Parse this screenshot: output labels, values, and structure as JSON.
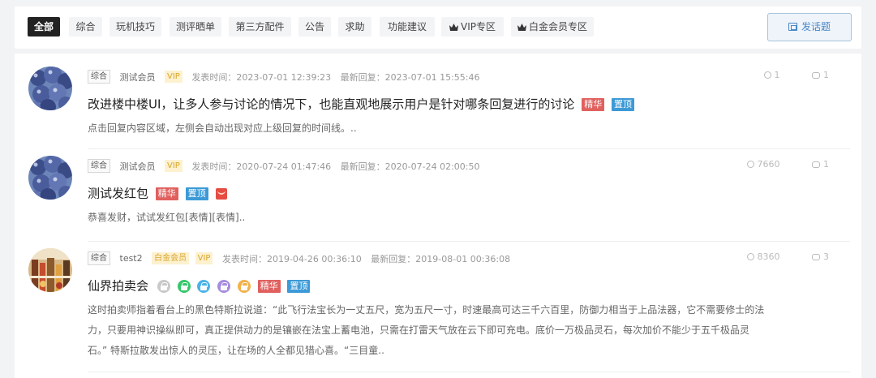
{
  "categories": [
    {
      "label": "全部",
      "active": true
    },
    {
      "label": "综合"
    },
    {
      "label": "玩机技巧"
    },
    {
      "label": "测评晒单"
    },
    {
      "label": "第三方配件"
    },
    {
      "label": "公告"
    },
    {
      "label": "求助"
    },
    {
      "label": "功能建议"
    },
    {
      "label": "VIP专区",
      "icon": "crown-icon"
    },
    {
      "label": "白金会员专区",
      "icon": "crown-icon"
    }
  ],
  "post_button": {
    "label": "发话题",
    "icon": "post-icon"
  },
  "posts": [
    {
      "category": "综合",
      "username": "测试会员",
      "badges": [
        "VIP"
      ],
      "posted": "发表时间：2023-07-01 12:39:23",
      "replied": "最新回复：2023-07-01 15:55:46",
      "views": "1",
      "replies": "1",
      "title": "改进楼中楼UI，让多人参与讨论的情况下，也能直观地展示用户是针对哪条回复进行的讨论",
      "flags": [
        "精华",
        "置顶"
      ],
      "excerpt": "点击回复内容区域，左侧会自动出现对应上级回复的时间线。.."
    },
    {
      "category": "综合",
      "username": "测试会员",
      "badges": [
        "VIP"
      ],
      "posted": "发表时间：2020-07-24 01:47:46",
      "replied": "最新回复：2020-07-24 02:00:50",
      "views": "7660",
      "replies": "1",
      "title": "测试发红包",
      "flags": [
        "精华",
        "置顶"
      ],
      "excerpt": "恭喜发财，试试发红包[表情][表情].."
    },
    {
      "category": "综合",
      "username": "test2",
      "badges": [
        "白金会员",
        "VIP"
      ],
      "posted": "发表时间：2019-04-26 00:36:10",
      "replied": "最新回复：2019-08-01 00:36:08",
      "views": "8360",
      "replies": "3",
      "title": "仙界拍卖会",
      "flags": [
        "精华",
        "置顶"
      ],
      "excerpt": "这时拍卖师指着看台上的黑色特斯拉说道：“此飞行法宝长为一丈五尺，宽为五尺一寸，时速最高可达三千六百里，防御力相当于上品法器，它不需要修士的法力，只要用神识操纵即可，真正提供动力的是镶嵌在法宝上蓄电池，只需在打雷天气放在云下即可充电。底价一万极品灵石，每次加价不能少于五千极品灵石。” 特斯拉散发出惊人的灵压，让在场的人全都见猎心喜。“三目童.."
    }
  ],
  "colors": {
    "accent": "#3d9ad6",
    "essence": "#e0605e",
    "vip": "#d9a52b",
    "active_tab": "#222222"
  },
  "lock_colors": [
    "#c9c9c9",
    "#35c76a",
    "#4bb3e8",
    "#a58ce0",
    "#f2b14a"
  ]
}
